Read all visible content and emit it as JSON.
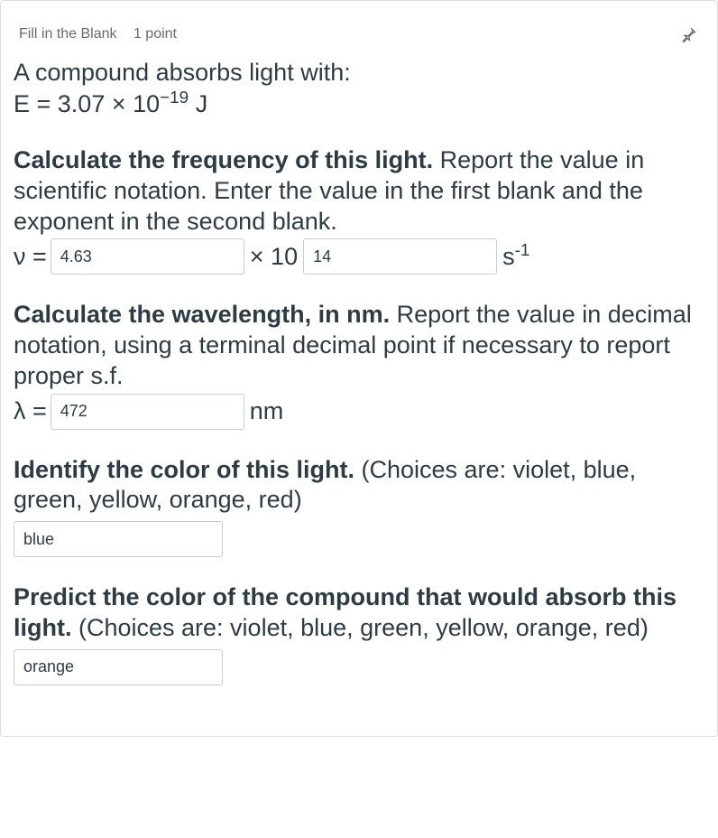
{
  "header": {
    "type": "Fill in the Blank",
    "points": "1 point"
  },
  "intro": {
    "line1": "A compound absorbs light with:",
    "line2_prefix": "E = 3.07 × 10",
    "line2_exp": "−19",
    "line2_suffix": " J"
  },
  "q1": {
    "bold": "Calculate the frequency of this light.",
    "rest": " Report the value in scientific notation. Enter the value in the first blank and the exponent in the second blank.",
    "var": "ν =",
    "val1": "4.63",
    "mid": "× 10",
    "val2": "14",
    "unit_base": "s",
    "unit_exp": "-1"
  },
  "q2": {
    "bold": "Calculate the wavelength, in nm.",
    "rest": " Report the value in decimal notation, using a terminal decimal point if necessary to report proper s.f.",
    "var": "λ =",
    "val": "472",
    "unit": "nm"
  },
  "q3": {
    "bold": "Identify the color of this light.",
    "rest": " (Choices are: violet, blue, green, yellow, orange, red)",
    "val": "blue"
  },
  "q4": {
    "bold": "Predict the color of the compound that would absorb this light.",
    "rest": " (Choices are: violet, blue, green, yellow, orange, red)",
    "val": "orange"
  }
}
